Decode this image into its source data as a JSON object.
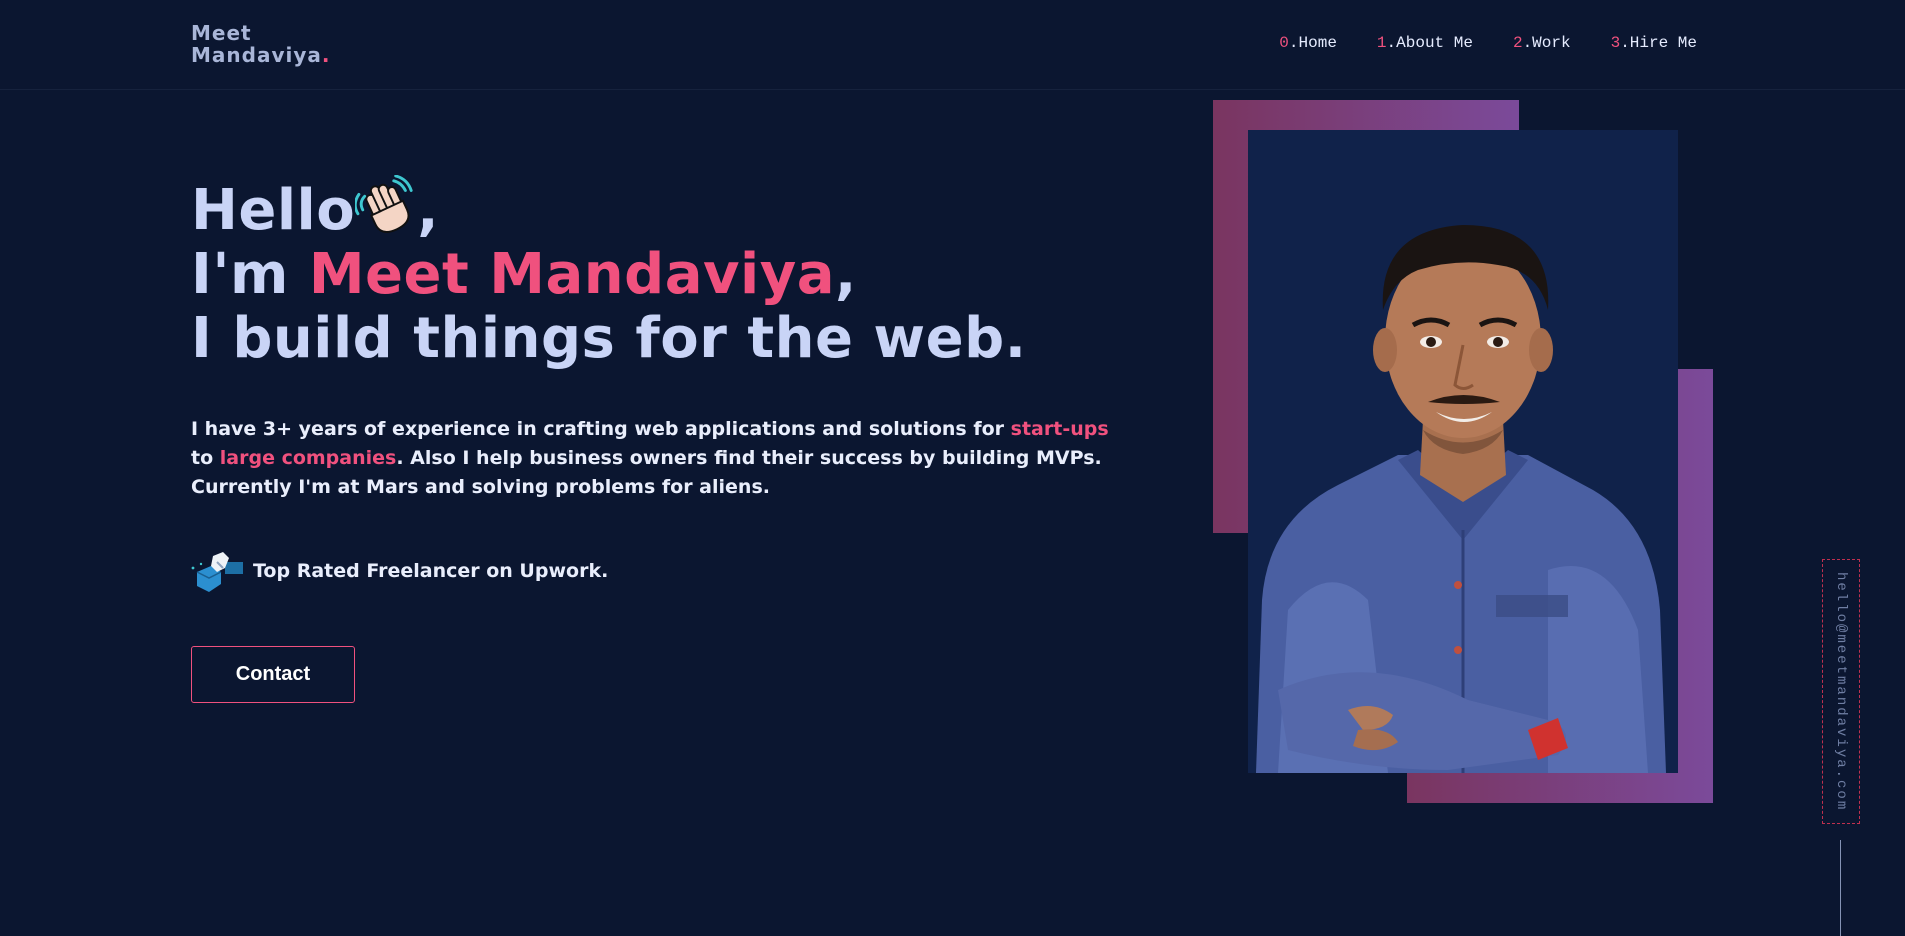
{
  "header": {
    "logo_line1": "Meet",
    "logo_line2": "Mandaviya",
    "logo_dot": ".",
    "nav": [
      {
        "num": "0",
        "label": ".Home"
      },
      {
        "num": "1",
        "label": ".About Me"
      },
      {
        "num": "2",
        "label": ".Work"
      },
      {
        "num": "3",
        "label": ".Hire Me"
      }
    ]
  },
  "hero": {
    "line1_start": "Hello",
    "line1_end": ",",
    "line2_start": "I'm ",
    "name": "Meet Mandaviya",
    "line2_end": ",",
    "line3": "I build things for the web.",
    "intro_part1": "I have 3+ years of experience in crafting web applications and solutions for ",
    "intro_hl1": "start-ups",
    "intro_part2": " to ",
    "intro_hl2": "large companies",
    "intro_part3": ". Also I help business owners find their success by building MVPs. Currently I'm at Mars and solving problems for aliens.",
    "badge_text": "Top Rated Freelancer on Upwork.",
    "contact_label": "Contact"
  },
  "side": {
    "email": "hello@meetmandaviya.com"
  },
  "colors": {
    "background": "#0b1630",
    "accent": "#f0517e",
    "text": "#ccd6f6"
  },
  "icons": {
    "wave": "waving-hand-icon",
    "upwork": "upwork-handshake-icon"
  }
}
